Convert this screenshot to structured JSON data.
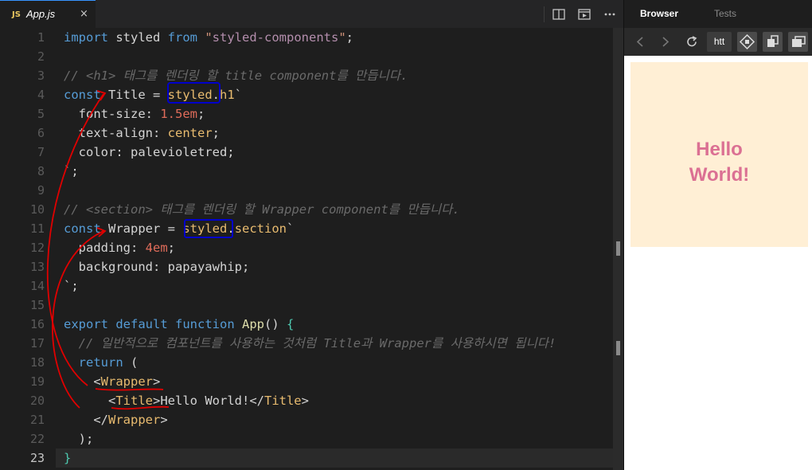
{
  "editor": {
    "tab": {
      "badge": "JS",
      "filename": "App.js",
      "close": "×"
    },
    "icons": [
      "split-editor-icon",
      "preview-icon",
      "more-icon"
    ],
    "line_numbers": [
      "1",
      "2",
      "3",
      "4",
      "5",
      "6",
      "7",
      "8",
      "9",
      "10",
      "11",
      "12",
      "13",
      "14",
      "15",
      "16",
      "17",
      "18",
      "19",
      "20",
      "21",
      "22",
      "23"
    ],
    "active_line": "23",
    "lines": [
      [
        {
          "c": "kw",
          "t": "import"
        },
        {
          "c": "id",
          "t": " styled "
        },
        {
          "c": "kw",
          "t": "from"
        },
        {
          "c": "plain",
          "t": " "
        },
        {
          "c": "str",
          "t": "\""
        },
        {
          "c": "strv",
          "t": "styled-components"
        },
        {
          "c": "str",
          "t": "\""
        },
        {
          "c": "plain",
          "t": ";"
        }
      ],
      [],
      [
        {
          "c": "cmt",
          "t": "// <h1> 태그를 렌더링 할 title component를 만듭니다."
        }
      ],
      [
        {
          "c": "kw",
          "t": "const"
        },
        {
          "c": "id",
          "t": " Title "
        },
        {
          "c": "plain",
          "t": "= "
        },
        {
          "c": "tmpl",
          "t": "styled"
        },
        {
          "c": "plain",
          "t": "."
        },
        {
          "c": "tmpl",
          "t": "h1"
        },
        {
          "c": "plain",
          "t": "`"
        }
      ],
      [
        {
          "c": "prop",
          "t": "  font-size"
        },
        {
          "c": "plain",
          "t": ": "
        },
        {
          "c": "num",
          "t": "1.5em"
        },
        {
          "c": "plain",
          "t": ";"
        }
      ],
      [
        {
          "c": "prop",
          "t": "  text-align"
        },
        {
          "c": "plain",
          "t": ": "
        },
        {
          "c": "val",
          "t": "center"
        },
        {
          "c": "plain",
          "t": ";"
        }
      ],
      [
        {
          "c": "prop",
          "t": "  color"
        },
        {
          "c": "plain",
          "t": ": palevioletred;"
        }
      ],
      [
        {
          "c": "plain",
          "t": "`;"
        }
      ],
      [],
      [
        {
          "c": "cmt",
          "t": "// <section> 태그를 렌더링 할 Wrapper component를 만듭니다."
        }
      ],
      [
        {
          "c": "kw",
          "t": "const"
        },
        {
          "c": "id",
          "t": " Wrapper "
        },
        {
          "c": "plain",
          "t": "= "
        },
        {
          "c": "tmpl",
          "t": "styled"
        },
        {
          "c": "plain",
          "t": "."
        },
        {
          "c": "tmpl",
          "t": "section"
        },
        {
          "c": "plain",
          "t": "`"
        }
      ],
      [
        {
          "c": "prop",
          "t": "  padding"
        },
        {
          "c": "plain",
          "t": ": "
        },
        {
          "c": "num",
          "t": "4em"
        },
        {
          "c": "plain",
          "t": ";"
        }
      ],
      [
        {
          "c": "prop",
          "t": "  background"
        },
        {
          "c": "plain",
          "t": ": papayawhip;"
        }
      ],
      [
        {
          "c": "plain",
          "t": "`;"
        }
      ],
      [],
      [
        {
          "c": "kw",
          "t": "export"
        },
        {
          "c": "plain",
          "t": " "
        },
        {
          "c": "kw",
          "t": "default"
        },
        {
          "c": "plain",
          "t": " "
        },
        {
          "c": "kw",
          "t": "function"
        },
        {
          "c": "plain",
          "t": " "
        },
        {
          "c": "fn",
          "t": "App"
        },
        {
          "c": "plain",
          "t": "() "
        },
        {
          "c": "brace",
          "t": "{"
        }
      ],
      [
        {
          "c": "cmt",
          "t": "  // 일반적으로 컴포넌트를 사용하는 것처럼 Title과 Wrapper를 사용하시면 됩니다!"
        }
      ],
      [
        {
          "c": "kw",
          "t": "  return"
        },
        {
          "c": "plain",
          "t": " ("
        }
      ],
      [
        {
          "c": "plain",
          "t": "    <"
        },
        {
          "c": "tag",
          "t": "Wrapper"
        },
        {
          "c": "plain",
          "t": ">"
        }
      ],
      [
        {
          "c": "plain",
          "t": "      <"
        },
        {
          "c": "tag",
          "t": "Title"
        },
        {
          "c": "plain",
          "t": ">Hello World!</"
        },
        {
          "c": "tag",
          "t": "Title"
        },
        {
          "c": "plain",
          "t": ">"
        }
      ],
      [
        {
          "c": "plain",
          "t": "    </"
        },
        {
          "c": "tag",
          "t": "Wrapper"
        },
        {
          "c": "plain",
          "t": ">"
        }
      ],
      [
        {
          "c": "plain",
          "t": "  );"
        }
      ],
      [
        {
          "c": "brace",
          "t": "}"
        }
      ]
    ]
  },
  "browser": {
    "tabs": {
      "browser": "Browser",
      "tests": "Tests"
    },
    "toolbar": {
      "url": "htt",
      "icons": [
        "back-icon",
        "forward-icon",
        "reload-icon",
        "devtools-icon",
        "new-window-icon",
        "fullscreen-icon"
      ]
    },
    "preview": {
      "title_line1": "Hello",
      "title_line2": "World!",
      "wrapper_bg": "#ffefd5",
      "title_color": "#db7093"
    }
  },
  "colors": {
    "editor_bg": "#1e1e1e",
    "accent": "#3794ff",
    "annotation_red": "#e00000",
    "annotation_blue": "#0000cc"
  }
}
